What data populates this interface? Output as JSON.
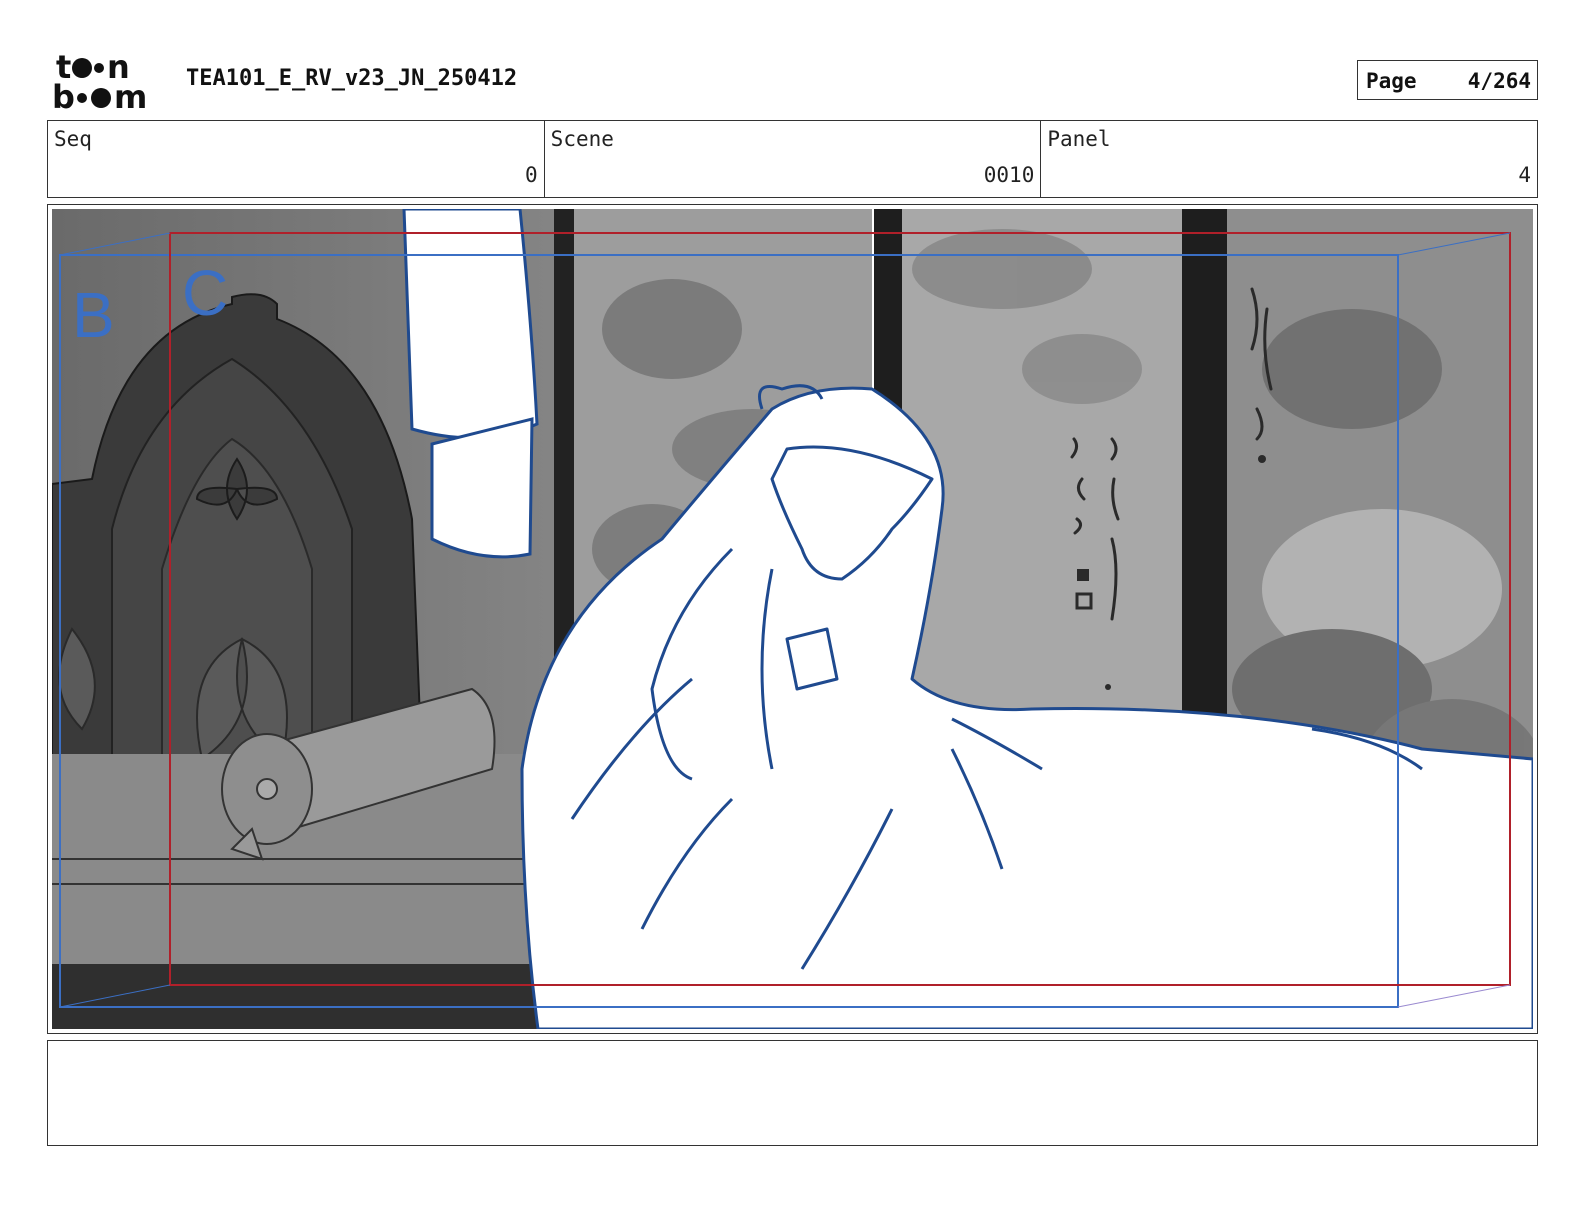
{
  "header": {
    "logo_text": "toon boom",
    "doc_title": "TEA101_E_RV_v23_JN_250412",
    "page_label": "Page",
    "page_value": "4/264"
  },
  "info": {
    "seq_label": "Seq",
    "seq_value": "0",
    "scene_label": "Scene",
    "scene_value": "0010",
    "panel_label": "Panel",
    "panel_value": "4"
  },
  "frame_labels": {
    "b": "B",
    "c": "C"
  },
  "colors": {
    "frame_b": "#3b6fc4",
    "frame_c": "#b0202a",
    "sketch_line": "#1f4a8f"
  },
  "notes": {
    "text": ""
  }
}
